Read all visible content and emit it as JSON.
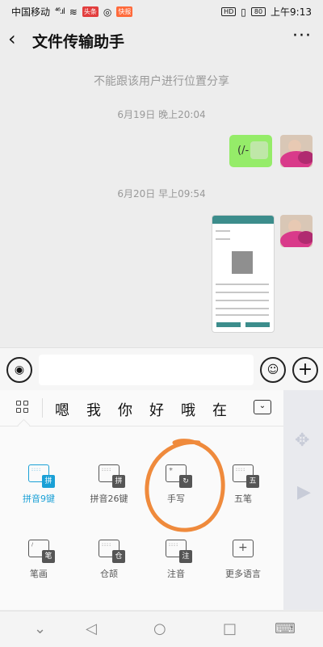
{
  "status_bar": {
    "carrier": "中国移动",
    "signal": "⁴⁶.ıl",
    "badge1": "头条",
    "badge2": "快报",
    "hd": "HD",
    "battery": "80",
    "time": "上午9:13"
  },
  "header": {
    "back_icon": "‹",
    "title": "文件传输助手",
    "more_icon": "···"
  },
  "chat": {
    "notice": "不能跟该用户进行位置分享",
    "time1": "6月19日 晚上20:04",
    "time2": "6月20日 早上09:54",
    "message_text": "(/-"
  },
  "input_bar": {
    "voice_icon": "◉",
    "emoji_icon": "☺",
    "plus_icon": "+"
  },
  "keyboard": {
    "candidates": [
      "嗯",
      "我",
      "你",
      "好",
      "哦",
      "在"
    ],
    "collapse_icon": "⌄",
    "items": [
      {
        "label": "拼音9键",
        "tag": "拼",
        "active": true
      },
      {
        "label": "拼音26键",
        "tag": "拼",
        "active": false
      },
      {
        "label": "手写",
        "tag": "↻",
        "active": false
      },
      {
        "label": "五笔",
        "tag": "五",
        "active": false
      },
      {
        "label": "笔画",
        "tag": "笔",
        "active": false
      },
      {
        "label": "仓颉",
        "tag": "仓",
        "active": false
      },
      {
        "label": "注音",
        "tag": "注",
        "active": false
      },
      {
        "label": "更多语言",
        "tag": "+",
        "active": false
      }
    ],
    "accent_color": "#1aa0d6",
    "annotation_color": "#ef8a3c"
  },
  "nav_bar": {
    "icons": [
      "⌄",
      "◁",
      "○",
      "□",
      "⌨"
    ]
  }
}
